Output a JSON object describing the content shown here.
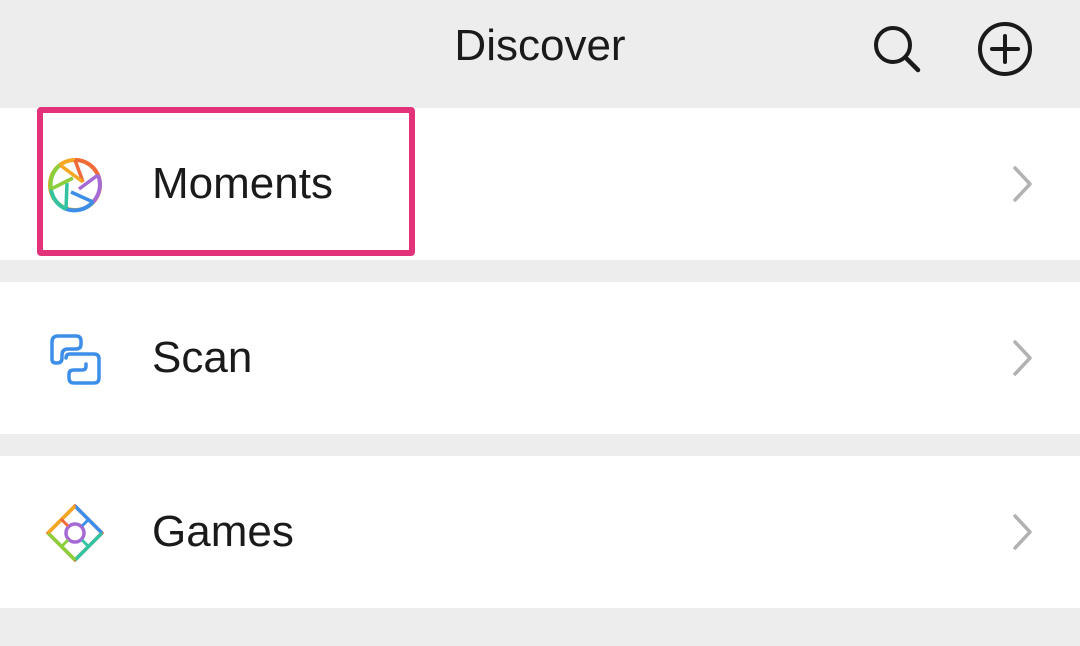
{
  "header": {
    "title": "Discover",
    "search_icon": "search-icon",
    "add_icon": "plus-circle-icon"
  },
  "menu": {
    "items": [
      {
        "label": "Moments",
        "icon": "moments-aperture-icon"
      },
      {
        "label": "Scan",
        "icon": "scan-icon"
      },
      {
        "label": "Games",
        "icon": "games-diamond-icon"
      }
    ]
  },
  "colors": {
    "background": "#ededed",
    "row_background": "#ffffff",
    "text": "#1a1a1a",
    "chevron": "#b2b2b2",
    "highlight": "#e2337a",
    "scan_blue": "#3d8ee8"
  }
}
